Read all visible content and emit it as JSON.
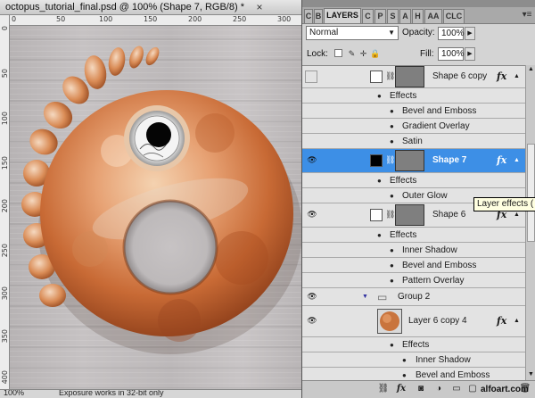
{
  "document": {
    "tab_title": "octopus_tutorial_final.psd @ 100% (Shape 7, RGB/8) *",
    "close_glyph": "×",
    "status_zoom": "100%",
    "status_text": "Exposure works in 32-bit only"
  },
  "rulers": {
    "top_labels": [
      "0",
      "50",
      "100",
      "150",
      "200",
      "250",
      "300"
    ],
    "left_labels": [
      "0",
      "50",
      "100",
      "150",
      "200",
      "250",
      "300",
      "350",
      "400"
    ]
  },
  "panel": {
    "tabs": [
      {
        "label": "C"
      },
      {
        "label": "B"
      },
      {
        "label": "LAYERS"
      },
      {
        "label": "C"
      },
      {
        "label": "P"
      },
      {
        "label": "S"
      },
      {
        "label": "A"
      },
      {
        "label": "H"
      },
      {
        "label": "AA"
      },
      {
        "label": "CLC"
      }
    ],
    "menu_icon": "panel-menu-icon",
    "blend_mode": "Normal",
    "opacity_label": "Opacity:",
    "opacity_value": "100%",
    "lock_label": "Lock:",
    "fill_label": "Fill:",
    "fill_value": "100%"
  },
  "layers": {
    "effects_label": "Effects",
    "rows": [
      {
        "name": "Shape 6 copy",
        "fx": "fx"
      },
      {
        "effect": "Bevel and Emboss"
      },
      {
        "effect": "Gradient Overlay"
      },
      {
        "effect": "Satin"
      },
      {
        "name": "Shape 7",
        "fx": "fx"
      },
      {
        "effect": "Outer Glow"
      },
      {
        "name": "Shape 6",
        "fx": "fx"
      },
      {
        "effect": "Inner Shadow"
      },
      {
        "effect": "Bevel and Emboss"
      },
      {
        "effect": "Pattern Overlay"
      },
      {
        "group": "Group 2"
      },
      {
        "name": "Layer 6 copy 4",
        "fx": "fx"
      },
      {
        "effect": "Inner Shadow"
      },
      {
        "effect": "Bevel and Emboss"
      }
    ]
  },
  "tooltip": "Layer effects (",
  "watermark": "alfoart.com",
  "colors": {
    "selection": "#3d8fe6",
    "panel_bg": "#d4d4d4",
    "tooltip_bg": "#ffffe1"
  }
}
